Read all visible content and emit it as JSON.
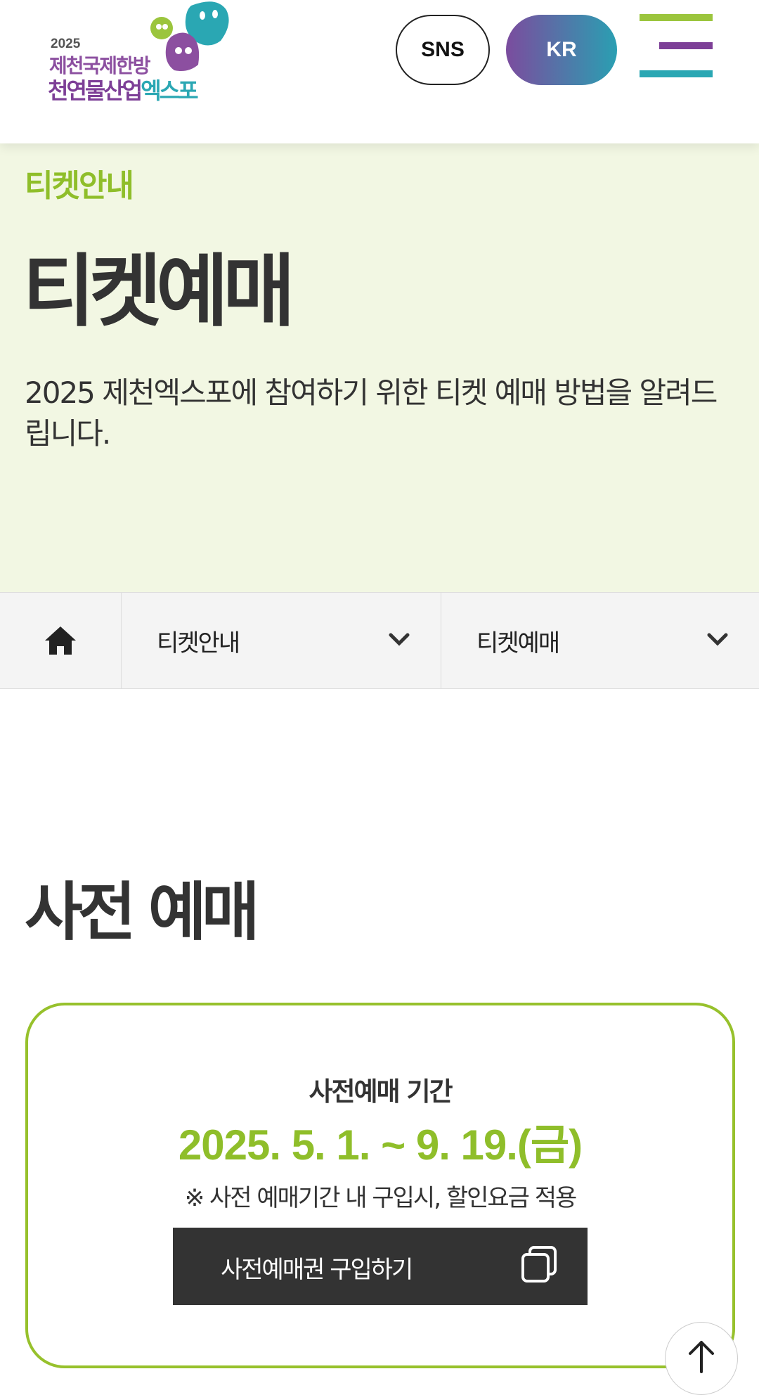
{
  "header": {
    "logo": {
      "year": "2025",
      "line1": "제천국제한방",
      "line2_main": "천연물산업",
      "line2_tail": "엑스포"
    },
    "sns_label": "SNS",
    "lang_label": "KR",
    "menu_icon": "hamburger-menu-icon"
  },
  "hero": {
    "kicker": "티켓안내",
    "title": "티켓예매",
    "description": "2025 제천엑스포에 참여하기 위한 티켓 예매 방법을 알려드립니다."
  },
  "breadcrumb": {
    "home_icon": "home-icon",
    "level1": "티켓안내",
    "level2": "티켓예매"
  },
  "section": {
    "title": "사전 예매"
  },
  "presale_card": {
    "label": "사전예매 기간",
    "date": "2025. 5. 1. ~ 9. 19.(금)",
    "note": "※ 사전 예매기간 내 구입시, 할인요금 적용",
    "button_label": "사전예매권 구입하기",
    "button_icon": "new-window-icon"
  },
  "scroll_top_icon": "arrow-up-icon",
  "colors": {
    "accent_green": "#8fbe2a",
    "hero_bg": "#f2f7e3",
    "brand_purple": "#7b4c9e",
    "brand_teal": "#2a9fb2",
    "dark": "#333333"
  }
}
